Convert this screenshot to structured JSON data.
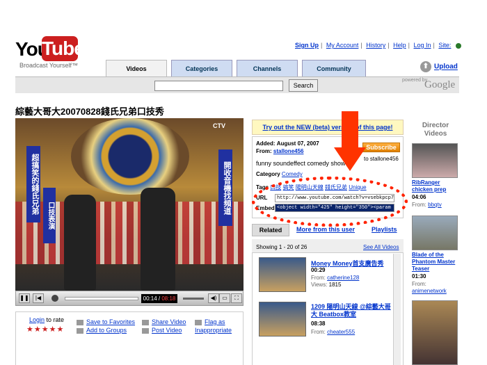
{
  "header": {
    "logo_you": "You",
    "logo_tube": "Tube",
    "tagline": "Broadcast Yourself™",
    "links": [
      "Sign Up",
      "My Account",
      "History",
      "Help",
      "Log In",
      "Site:"
    ],
    "upload": "Upload",
    "tabs": [
      "Videos",
      "Categories",
      "Channels",
      "Community"
    ],
    "search_button": "Search",
    "powered_by": "powered by",
    "google": "Google"
  },
  "video": {
    "title": "綜藝大哥大20070828錢氏兄弟口技秀",
    "sign_left": "超搞笑的錢氏兄弟",
    "sign_left2": "口技表演",
    "sign_right": "開收音機找頻道",
    "channel_logo": "CTV",
    "time_current": "00:14",
    "time_total": "08:18"
  },
  "below_player": {
    "login_to_rate": "Login",
    "to_rate": "to rate",
    "stars": "★★★★★",
    "actions": [
      "Save to Favorites",
      "Share Video",
      "Flag as",
      "Add to Groups",
      "Post Video",
      "Inappropriate"
    ]
  },
  "info": {
    "beta": "Try out the NEW (beta) version of this page!",
    "added_label": "Added:",
    "added_value": "August 07, 2007",
    "from_label": "From:",
    "from_user": "stallone456",
    "subscribe": "Subscribe",
    "subscribe_to": "to stallone456",
    "description": "funny soundeffect comedy show",
    "category_label": "Category",
    "category_value": "Comedy",
    "tags_label": "Tags",
    "tags": [
      "口技",
      "搞笑",
      "陽明山天線",
      "錢氏兄弟",
      "Unique"
    ],
    "url_label": "URL",
    "url_value": "http://www.youtube.com/watch?v=vsebkpcp71k",
    "embed_label": "Embed",
    "embed_value": "<object width=\"425\" height=\"350\"><param name"
  },
  "related": {
    "tab_related": "Related",
    "tab_more": "More from this user",
    "tab_playlists": "Playlists",
    "showing": "Showing 1 - 20 of 26",
    "see_all": "See All Videos",
    "items": [
      {
        "title": "Money Money首支廣告秀",
        "duration": "00:29",
        "from_label": "From:",
        "from": "catherine128",
        "views_label": "Views:",
        "views": "1815"
      },
      {
        "title": "1209 陽明山天線 @綜藝大哥大 Beatbox教室",
        "duration": "08:38",
        "from_label": "From:",
        "from": "cheater555"
      }
    ]
  },
  "director": {
    "heading": "Director Videos",
    "items": [
      {
        "title": "RibRanger chicken prep",
        "duration": "04:06",
        "from_label": "From:",
        "from": "bbqtv"
      },
      {
        "title": "Blade of the Phantom Master Teaser",
        "duration": "01:30",
        "from_label": "From:",
        "from": "animenetwork"
      }
    ]
  },
  "colors": {
    "brand_red": "#cc1f1f",
    "link_blue": "#0033cc",
    "annotation_red": "#ff2200",
    "subscribe_orange": "#e08000"
  }
}
